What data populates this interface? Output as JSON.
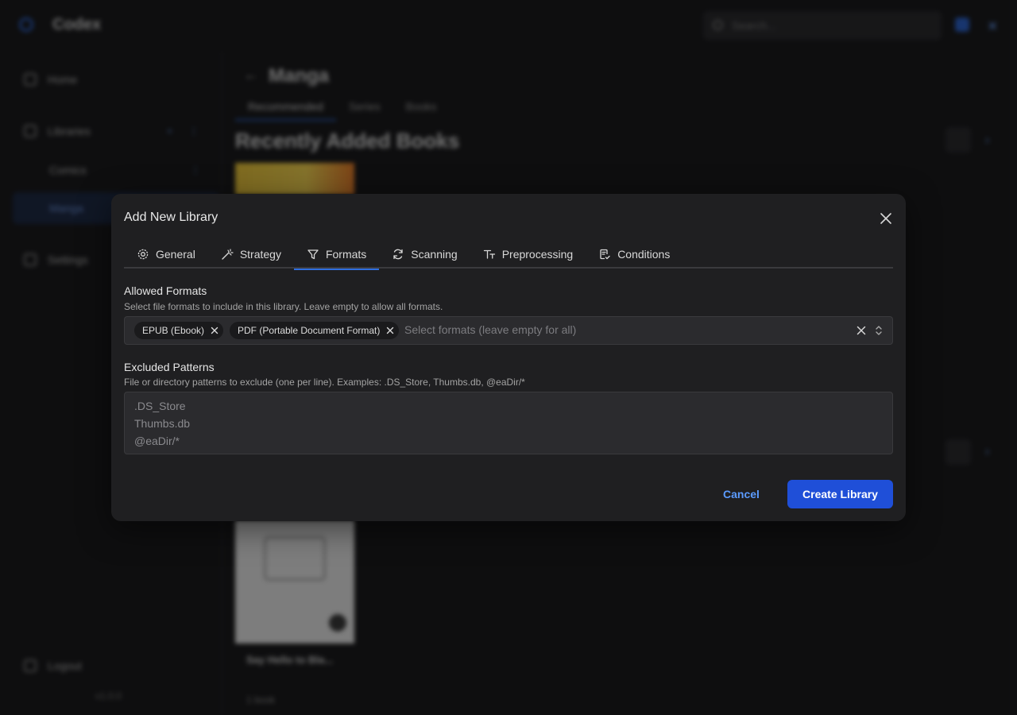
{
  "background": {
    "app_title": "Codex",
    "search_placeholder": "Search...",
    "sidebar": {
      "home": "Home",
      "libraries": "Libraries",
      "library_comics": "Comics",
      "library_manga": "Manga",
      "settings": "Settings",
      "logout": "Logout",
      "version": "v1.0.0"
    },
    "page_title": "Manga",
    "tabs": [
      "Recommended",
      "Series",
      "Books"
    ],
    "section_title": "Recently Added Books",
    "book_title": "Say Hello to Bla...",
    "book_meta": "1 book"
  },
  "modal": {
    "title": "Add New Library",
    "tabs": [
      {
        "label": "General",
        "icon": "gear-icon"
      },
      {
        "label": "Strategy",
        "icon": "wand-icon"
      },
      {
        "label": "Formats",
        "icon": "filter-icon"
      },
      {
        "label": "Scanning",
        "icon": "refresh-icon"
      },
      {
        "label": "Preprocessing",
        "icon": "text-size-icon"
      },
      {
        "label": "Conditions",
        "icon": "document-check-icon"
      }
    ],
    "active_tab": "Formats",
    "allowed_formats": {
      "label": "Allowed Formats",
      "description": "Select file formats to include in this library. Leave empty to allow all formats.",
      "selected": [
        "EPUB (Ebook)",
        "PDF (Portable Document Format)"
      ],
      "placeholder": "Select formats (leave empty for all)"
    },
    "excluded_patterns": {
      "label": "Excluded Patterns",
      "description": "File or directory patterns to exclude (one per line). Examples: .DS_Store, Thumbs.db, @eaDir/*",
      "placeholder_lines": [
        ".DS_Store",
        "Thumbs.db",
        "@eaDir/*"
      ]
    },
    "cancel_label": "Cancel",
    "create_label": "Create Library"
  },
  "colors": {
    "accent": "#1f4fd8",
    "link": "#5b9bff",
    "modal_bg": "#1f1f21"
  }
}
